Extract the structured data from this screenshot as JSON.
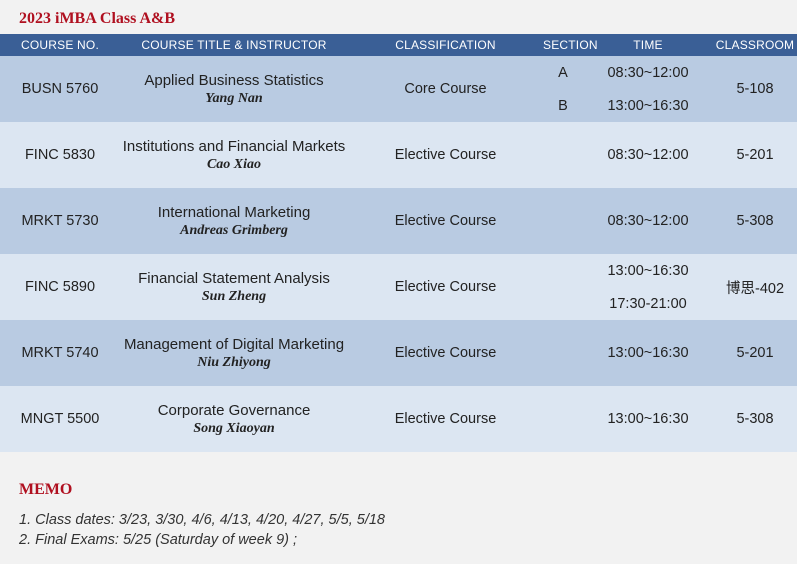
{
  "title": "2023 iMBA Class A&B",
  "headers": {
    "course_no": "COURSE NO.",
    "course_title": "COURSE TITLE & INSTRUCTOR",
    "classification": "CLASSIFICATION",
    "section": "SECTION",
    "time": "TIME",
    "classroom": "CLASSROOM"
  },
  "rows": [
    {
      "code": "BUSN 5760",
      "title": "Applied Business Statistics",
      "instructor": "Yang Nan",
      "classification": "Core Course",
      "sections": [
        "A",
        "B"
      ],
      "times": [
        "08:30~12:00",
        "13:00~16:30"
      ],
      "classroom": "5-108"
    },
    {
      "code": "FINC 5830",
      "title": "Institutions and Financial Markets",
      "instructor": "Cao Xiao",
      "classification": "Elective Course",
      "sections": [],
      "times": [
        "08:30~12:00"
      ],
      "classroom": "5-201"
    },
    {
      "code": "MRKT 5730",
      "title": "International Marketing",
      "instructor": "Andreas Grimberg",
      "classification": "Elective Course",
      "sections": [],
      "times": [
        "08:30~12:00"
      ],
      "classroom": "5-308"
    },
    {
      "code": "FINC 5890",
      "title": "Financial Statement Analysis",
      "instructor": "Sun Zheng",
      "classification": "Elective Course",
      "sections": [],
      "times": [
        "13:00~16:30",
        "17:30-21:00"
      ],
      "classroom": "博思-402"
    },
    {
      "code": "MRKT 5740",
      "title": "Management of Digital Marketing",
      "instructor": "Niu Zhiyong",
      "classification": "Elective Course",
      "sections": [],
      "times": [
        "13:00~16:30"
      ],
      "classroom": "5-201"
    },
    {
      "code": "MNGT 5500",
      "title": "Corporate Governance",
      "instructor": "Song Xiaoyan",
      "classification": "Elective Course",
      "sections": [],
      "times": [
        "13:00~16:30"
      ],
      "classroom": "5-308"
    }
  ],
  "memo": {
    "title": "MEMO",
    "lines": [
      "1. Class dates: 3/23, 3/30, 4/6, 4/13, 4/20, 4/27, 5/5, 5/18",
      "2. Final Exams: 5/25 (Saturday of week 9) ;"
    ]
  },
  "colors": {
    "header_bg": "#3a5f96",
    "row_dark": "#b9cbe2",
    "row_light": "#dce6f2",
    "accent_red": "#b01020"
  }
}
